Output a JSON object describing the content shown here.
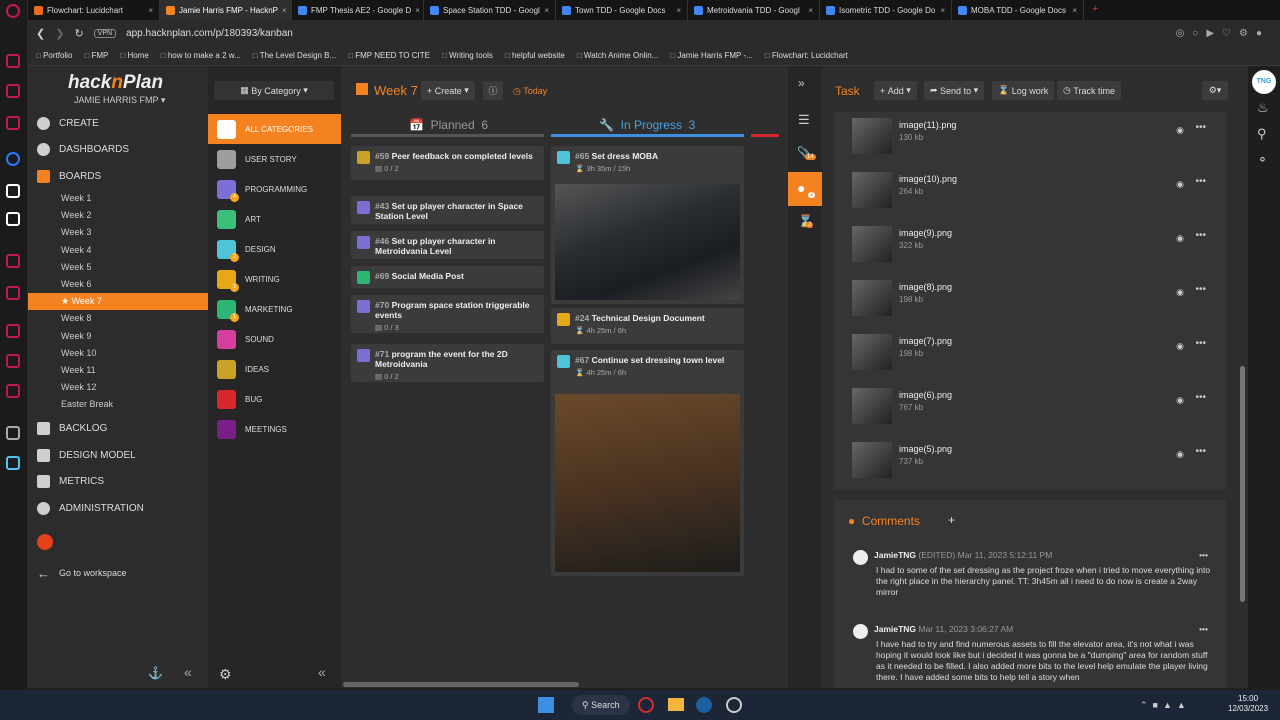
{
  "browser": {
    "tabs": [
      {
        "label": "Flowchart: Lucidchart",
        "color": "#f26b1d",
        "active": false
      },
      {
        "label": "Jamie Harris FMP - HacknP",
        "color": "#f58220",
        "active": true
      },
      {
        "label": "FMP Thesis AE2 - Google D",
        "color": "#4285f4",
        "active": false
      },
      {
        "label": "Space Station TDD - Googl",
        "color": "#4285f4",
        "active": false
      },
      {
        "label": "Town TDD - Google Docs",
        "color": "#4285f4",
        "active": false
      },
      {
        "label": "Metroidvania TDD - Googl",
        "color": "#4285f4",
        "active": false
      },
      {
        "label": "Isometric TDD - Google Do",
        "color": "#4285f4",
        "active": false
      },
      {
        "label": "MOBA TDD - Google Docs",
        "color": "#4285f4",
        "active": false
      }
    ],
    "vpn": "VPN",
    "url": "app.hacknplan.com/p/180393/kanban",
    "bookmarks": [
      "Portfolio",
      "FMP",
      "Home",
      "how to make a 2 w...",
      "The Level Design B...",
      "FMP NEED TO CITE",
      "Writing tools",
      "helpful website",
      "Watch Anime Onlin...",
      "Jamie Harris FMP -...",
      "Flowchart: Lucidchart"
    ]
  },
  "app": {
    "logo_a": "hack",
    "logo_b": "n",
    "logo_c": "Plan",
    "workspace": "JAMIE HARRIS FMP",
    "nav": {
      "create": "CREATE",
      "dashboards": "DASHBOARDS",
      "boards": "BOARDS",
      "backlog": "BACKLOG",
      "design_model": "DESIGN MODEL",
      "metrics": "METRICS",
      "administration": "ADMINISTRATION",
      "goto": "Go to workspace"
    },
    "weeks": [
      "Week 1",
      "Week 2",
      "Week 3",
      "Week 4",
      "Week 5",
      "Week 6",
      "Week 7",
      "Week 8",
      "Week 9",
      "Week 10",
      "Week 11",
      "Week 12",
      "Easter Break"
    ],
    "selected_week": "Week 7",
    "group_by": "By Category",
    "categories": [
      {
        "label": "ALL CATEGORIES",
        "color": "#f58220",
        "badge": ""
      },
      {
        "label": "USER STORY",
        "color": "#9e9e9e",
        "badge": ""
      },
      {
        "label": "PROGRAMMING",
        "color": "#7b6fd6",
        "badge": "4"
      },
      {
        "label": "ART",
        "color": "#3cbf7a",
        "badge": ""
      },
      {
        "label": "DESIGN",
        "color": "#4fc3d7",
        "badge": "2"
      },
      {
        "label": "WRITING",
        "color": "#e6a817",
        "badge": "1"
      },
      {
        "label": "MARKETING",
        "color": "#2bb673",
        "badge": "1"
      },
      {
        "label": "SOUND",
        "color": "#d63fa0",
        "badge": ""
      },
      {
        "label": "IDEAS",
        "color": "#c9a227",
        "badge": ""
      },
      {
        "label": "BUG",
        "color": "#d9272e",
        "badge": ""
      },
      {
        "label": "MEETINGS",
        "color": "#7a1f8a",
        "badge": ""
      }
    ]
  },
  "board": {
    "title": "Week 7",
    "create": "Create",
    "today": "Today",
    "columns": [
      {
        "label": "Planned",
        "count": "6"
      },
      {
        "label": "In Progress",
        "count": "3"
      }
    ],
    "planned": [
      {
        "id": "#59",
        "title": "Peer feedback on completed levels",
        "meta": "0 / 2",
        "color": "#c9a227"
      },
      {
        "id": "#43",
        "title": "Set up player character in Space Station Level",
        "meta": "",
        "color": "#7b6fd6"
      },
      {
        "id": "#46",
        "title": "Set up player character in Metroidvania Level",
        "meta": "",
        "color": "#7b6fd6"
      },
      {
        "id": "#69",
        "title": "Social Media Post",
        "meta": "",
        "color": "#2bb673"
      },
      {
        "id": "#70",
        "title": "Program space station triggerable events",
        "meta": "0 / 3",
        "color": "#7b6fd6"
      },
      {
        "id": "#71",
        "title": "program the event for the 2D Metroidvania",
        "meta": "0 / 2",
        "color": "#7b6fd6"
      }
    ],
    "in_progress": [
      {
        "id": "#65",
        "title": "Set dress MOBA",
        "meta": "3h 35m / 15h",
        "color": "#4fc3d7"
      },
      {
        "id": "#24",
        "title": "Technical Design Document",
        "meta": "4h 25m / 6h",
        "color": "#e6a817"
      },
      {
        "id": "#67",
        "title": "Continue set dressing town level",
        "meta": "4h 25m / 6h",
        "color": "#4fc3d7"
      }
    ]
  },
  "sidebar_badges": {
    "attachments": "14",
    "comments": "2",
    "time": "2"
  },
  "task": {
    "title": "Task",
    "add": "Add",
    "send_to": "Send to",
    "log_work": "Log work",
    "track_time": "Track time",
    "attachments": [
      {
        "name": "image(11).png",
        "size": "130 kb"
      },
      {
        "name": "image(10).png",
        "size": "264 kb"
      },
      {
        "name": "image(9).png",
        "size": "322 kb"
      },
      {
        "name": "image(8).png",
        "size": "198 kb"
      },
      {
        "name": "image(7).png",
        "size": "198 kb"
      },
      {
        "name": "image(6).png",
        "size": "767 kb"
      },
      {
        "name": "image(5).png",
        "size": "737 kb"
      }
    ],
    "comments_title": "Comments",
    "comments": [
      {
        "author": "JamieTNG",
        "edited": "(EDITED)",
        "date": "Mar 11, 2023 5:12:11 PM",
        "text": "I had to some of the set dressing as the project froze when i tried to move everything into the right place in the hierarchy panel. TT: 3h45m all i need to do now is create a 2way mirror"
      },
      {
        "author": "JamieTNG",
        "edited": "",
        "date": "Mar 11, 2023 3:06:27 AM",
        "text": "I have had to try and find numerous assets to fill the elevator area, it's not what i was hoping it would look like but i decided it was gonna be a \"dumping\" area for random stuff as it needed to be filled. I also added more bits to the level help emulate the player living there. I have added some bits to help tell a story when"
      }
    ]
  },
  "taskbar": {
    "search": "Search",
    "time": "15:00",
    "date": "12/03/2023"
  }
}
